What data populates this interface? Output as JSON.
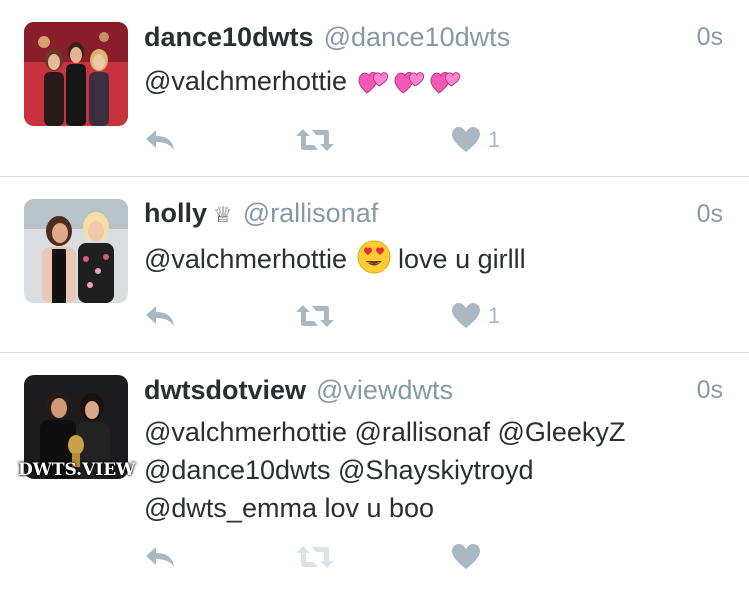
{
  "tweets": [
    {
      "name": "dance10dwts",
      "handle": "@dance10dwts",
      "crown": "",
      "time": "0s",
      "text": "@valchmerhottie",
      "emoji": [
        "two-hearts",
        "two-hearts",
        "two-hearts"
      ],
      "like_count": "1",
      "retweet_enabled": true
    },
    {
      "name": "holly",
      "handle": "@rallisonaf",
      "crown": "♕",
      "time": "0s",
      "text": "@valchmerhottie",
      "text_after": "love u girlll",
      "emoji": [
        "heart-eyes"
      ],
      "like_count": "1",
      "retweet_enabled": true
    },
    {
      "name": "dwtsdotview",
      "handle": "@viewdwts",
      "crown": "",
      "time": "0s",
      "lines": [
        "@valchmerhottie @rallisonaf @GleekyZ",
        "@dance10dwts @Shayskiytroyd",
        "@dwts_emma lov u boo"
      ],
      "avatar_watermark": "DWTS.VIEW",
      "like_count": "",
      "retweet_enabled": false
    }
  ],
  "colors": {
    "icon": "#aab8c2",
    "icon_disabled": "#dbe3e8",
    "handle": "#8899a6",
    "text": "#292f33",
    "divider": "#d8dde1"
  }
}
